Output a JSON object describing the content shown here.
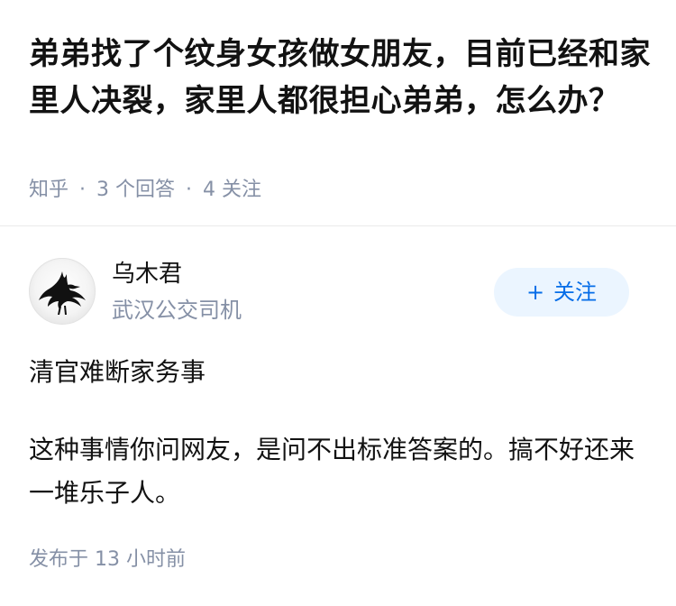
{
  "question": {
    "title": "弟弟找了个纹身女孩做女朋友，目前已经和家里人决裂，家里人都很担心弟弟，怎么办？",
    "source": "知乎",
    "separator": "·",
    "answers_count": "3 个回答",
    "followers_count": "4 关注"
  },
  "answer": {
    "author": {
      "name": "乌木君",
      "bio": "武汉公交司机",
      "avatar_icon": "crow-icon"
    },
    "follow_button": {
      "plus": "+",
      "label": "关注"
    },
    "paragraphs": [
      "清官难断家务事",
      "这种事情你问网友，是问不出标准答案的。搞不好还来一堆乐子人。"
    ],
    "published": "发布于 13 小时前"
  },
  "colors": {
    "text": "#121212",
    "meta": "#8590a6",
    "accent": "#056de8",
    "follow_bg": "#ebf5ff"
  }
}
